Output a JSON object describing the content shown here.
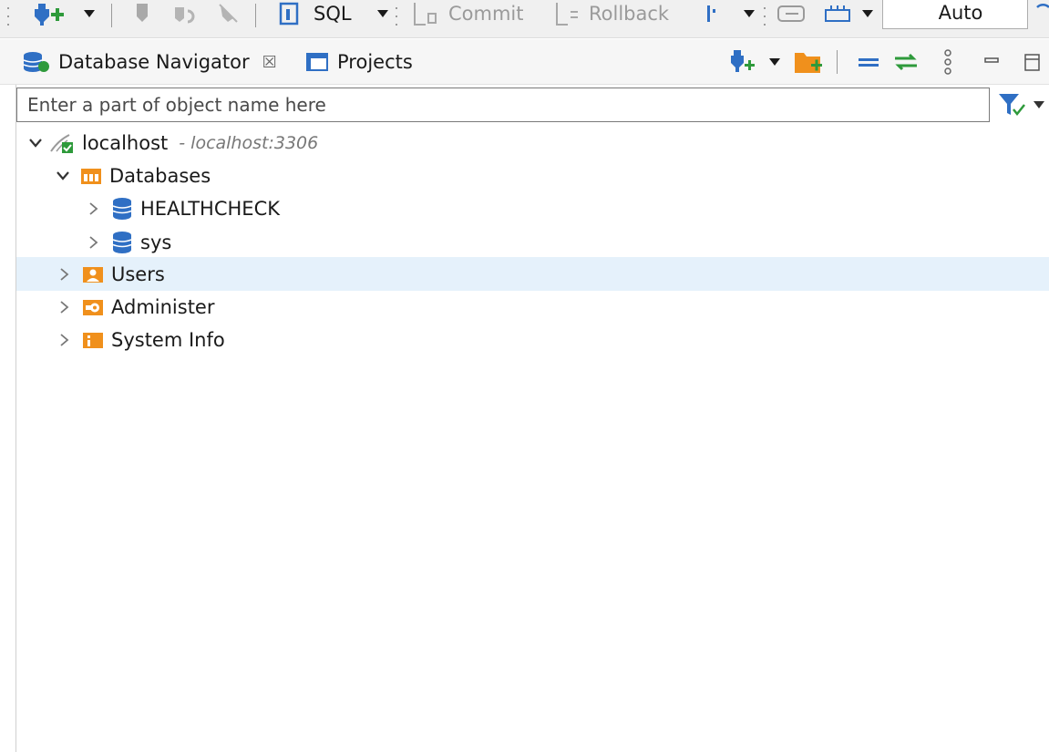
{
  "toolbar": {
    "sql_label": "SQL",
    "commit_label": "Commit",
    "rollback_label": "Rollback",
    "transaction_mode": "Auto"
  },
  "tabs": [
    {
      "label": "Database Navigator",
      "active": true,
      "closable": true
    },
    {
      "label": "Projects",
      "active": false
    }
  ],
  "filter": {
    "placeholder": "Enter a part of object name here",
    "value": ""
  },
  "tree": {
    "connection": {
      "label": "localhost",
      "detail": "- localhost:3306",
      "expanded": true
    },
    "databases_folder": {
      "label": "Databases",
      "expanded": true
    },
    "databases": [
      {
        "label": "HEALTHCHECK"
      },
      {
        "label": "sys"
      }
    ],
    "folders": [
      {
        "label": "Users",
        "selected": true
      },
      {
        "label": "Administer"
      },
      {
        "label": "System Info"
      }
    ]
  },
  "colors": {
    "selection": "#e5f1fb",
    "folder_orange": "#f0901c",
    "db_blue": "#2f6fc4",
    "accent_green": "#2e9a3b"
  }
}
